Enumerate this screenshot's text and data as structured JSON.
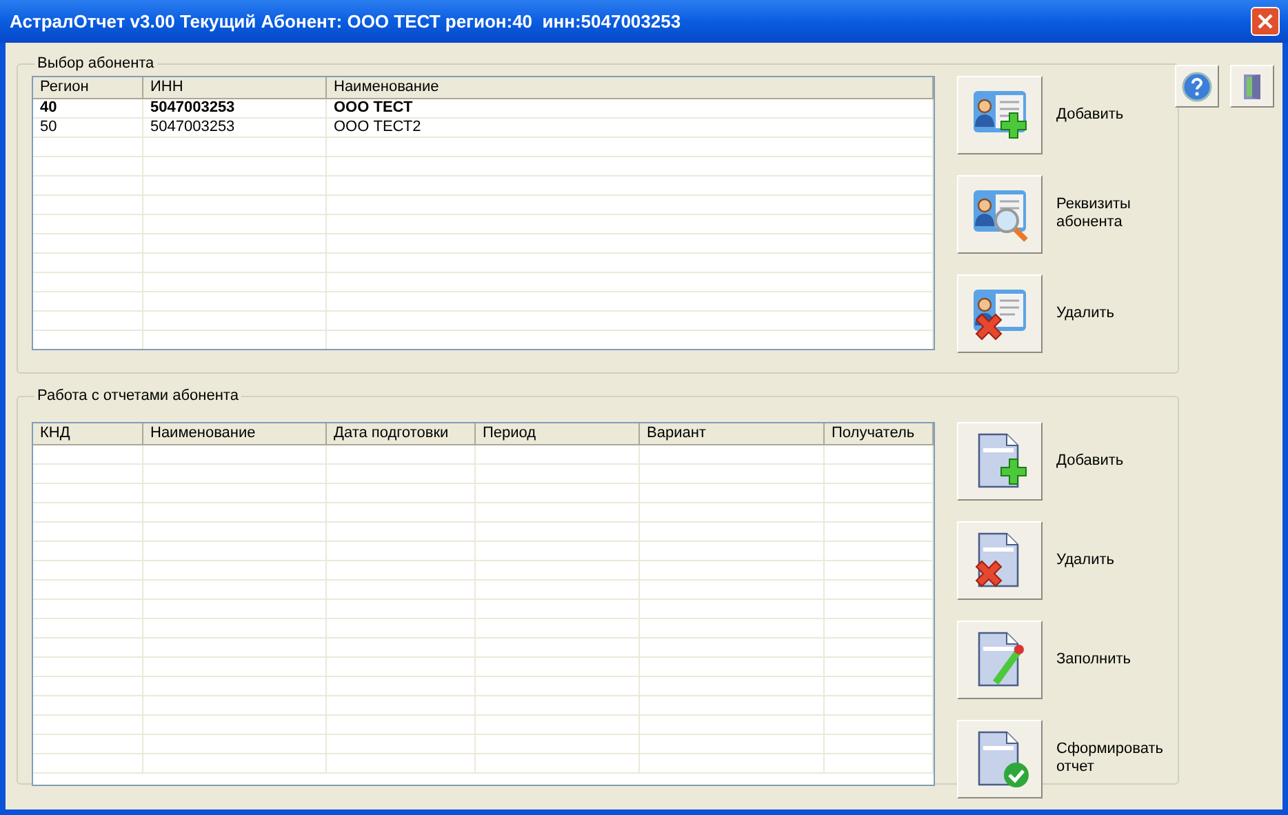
{
  "window": {
    "title": "АстралОтчет v3.00 Текущий Абонент: ООО ТЕСТ регион:40  инн:5047003253"
  },
  "subscribers": {
    "title": "Выбор абонента",
    "columns": [
      "Регион",
      "ИНН",
      "Наименование"
    ],
    "rows": [
      {
        "cells": [
          "40",
          "5047003253",
          "ООО ТЕСТ"
        ],
        "current": true
      },
      {
        "cells": [
          "50",
          "5047003253",
          "ООО ТЕСТ2"
        ],
        "current": false
      }
    ],
    "buttons": [
      {
        "kind": "card-add",
        "label": "Добавить"
      },
      {
        "kind": "card-search",
        "label": "Реквизиты абонента"
      },
      {
        "kind": "card-delete",
        "label": "Удалить"
      }
    ]
  },
  "reports": {
    "title": "Работа с отчетами абонента",
    "columns": [
      "КНД",
      "Наименование",
      "Дата подготовки",
      "Период",
      "Вариант",
      "Получатель"
    ],
    "buttons": [
      {
        "kind": "doc-add",
        "label": "Добавить"
      },
      {
        "kind": "doc-delete",
        "label": "Удалить"
      },
      {
        "kind": "doc-edit",
        "label": "Заполнить"
      },
      {
        "kind": "doc-check",
        "label": "Сформировать отчет"
      }
    ]
  },
  "toolbar": [
    {
      "kind": "help"
    },
    {
      "kind": "exit"
    }
  ]
}
